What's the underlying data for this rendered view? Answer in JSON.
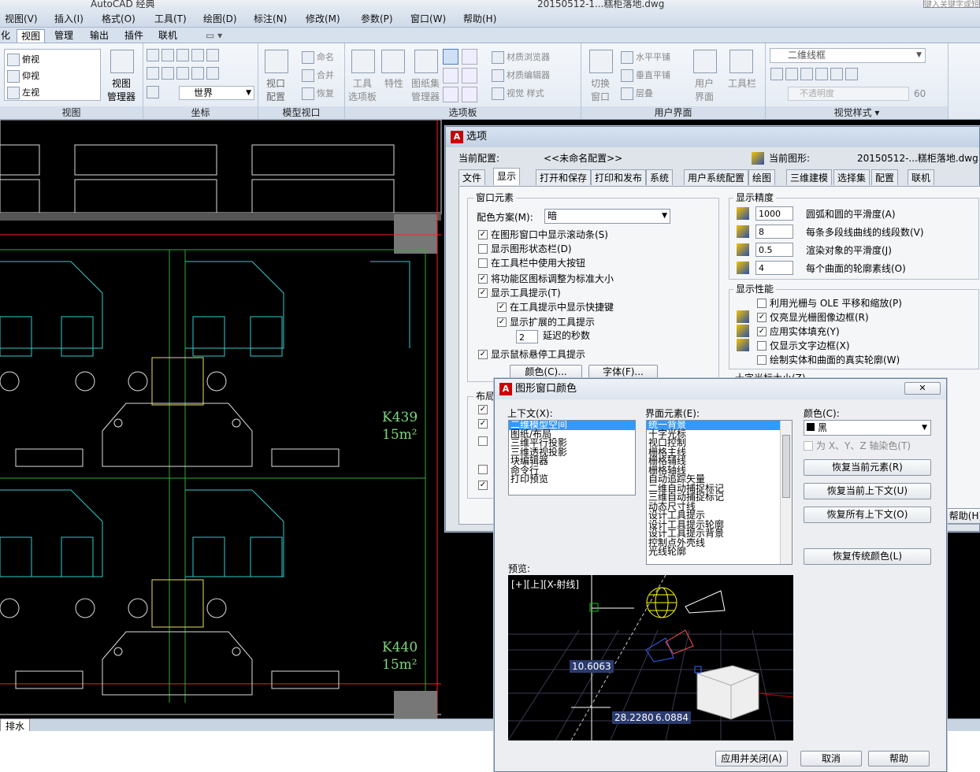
{
  "app": {
    "title_fragments": [
      "AutoCAD 经典",
      "20150512-1...糕柜落地.dwg"
    ],
    "search_placeholder": "键入关键字或短语"
  },
  "menu": [
    "视图(V)",
    "插入(I)",
    "格式(O)",
    "工具(T)",
    "绘图(D)",
    "标注(N)",
    "修改(M)",
    "参数(P)",
    "窗口(W)",
    "帮助(H)"
  ],
  "ribbon_tabs": [
    "化",
    "视图",
    "管理",
    "输出",
    "插件",
    "联机"
  ],
  "ribbon": {
    "view_group": {
      "items": [
        "俯视",
        "仰视",
        "左视"
      ],
      "big_button": "视图\n管理器",
      "label": "视图"
    },
    "coords_group": {
      "world": "世界",
      "label": "坐标"
    },
    "model_viewport_group": {
      "config": "视口\n配置",
      "items": [
        "命名",
        "合并",
        "恢复"
      ],
      "label": "模型视口"
    },
    "palettes_group": {
      "buttons": [
        "工具\n选项板",
        "特性",
        "图纸集\n管理器"
      ],
      "label": "选项板"
    },
    "ui_group": {
      "items": [
        "材质浏览器",
        "材质编辑器",
        "视觉 样式"
      ],
      "switch": "切换\n窗口",
      "tile": [
        "水平平铺",
        "垂直平铺",
        "层叠"
      ],
      "user_ui": "用户\n界面",
      "toolbar": "工具栏",
      "label": "用户界面"
    },
    "visual_styles_group": {
      "style": "二维线框",
      "opacity_label": "不透明度",
      "opacity_value": "60",
      "label": "视觉样式"
    }
  },
  "drawing": {
    "room_labels": [
      {
        "name": "K439",
        "area": "15m²"
      },
      {
        "name": "K440",
        "area": "15m²"
      }
    ],
    "tab_label": "排水",
    "colors": {
      "background": "#000000",
      "lines": "#ffffff",
      "cyan": "#33cccc",
      "green": "#33aa33",
      "red": "#ff2020",
      "yellow": "#e8e060",
      "label": "#7dd87d"
    }
  },
  "options": {
    "title": "选项",
    "current_profile_label": "当前配置:",
    "current_profile_value": "<<未命名配置>>",
    "current_drawing_label": "当前图形:",
    "current_drawing_value": "20150512-...糕柜落地.dwg",
    "tabs": [
      "文件",
      "显示",
      "打开和保存",
      "打印和发布",
      "系统",
      "用户系统配置",
      "绘图",
      "三维建模",
      "选择集",
      "配置",
      "联机"
    ],
    "window_elements": {
      "title": "窗口元素",
      "scheme_label": "配色方案(M):",
      "scheme_value": "暗",
      "checks": [
        {
          "label": "在图形窗口中显示滚动条(S)",
          "on": true
        },
        {
          "label": "显示图形状态栏(D)",
          "on": false
        },
        {
          "label": "在工具栏中使用大按钮",
          "on": false
        },
        {
          "label": "将功能区图标调整为标准大小",
          "on": true
        },
        {
          "label": "显示工具提示(T)",
          "on": true
        },
        {
          "label": "在工具提示中显示快捷键",
          "on": true
        },
        {
          "label": "显示扩展的工具提示",
          "on": true
        }
      ],
      "delay_value": "2",
      "delay_label": "延迟的秒数",
      "hover_label": "显示鼠标悬停工具提示",
      "colors_btn": "颜色(C)...",
      "fonts_btn": "字体(F)..."
    },
    "layout_title": "布局",
    "display_resolution": {
      "title": "显示精度",
      "rows": [
        {
          "value": "1000",
          "label": "圆弧和圆的平滑度(A)"
        },
        {
          "value": "8",
          "label": "每条多段线曲线的线段数(V)"
        },
        {
          "value": "0.5",
          "label": "渲染对象的平滑度(J)"
        },
        {
          "value": "4",
          "label": "每个曲面的轮廓素线(O)"
        }
      ]
    },
    "display_performance": {
      "title": "显示性能",
      "checks": [
        {
          "label": "利用光栅与 OLE 平移和缩放(P)",
          "on": false
        },
        {
          "label": "仅亮显光栅图像边框(R)",
          "on": true
        },
        {
          "label": "应用实体填充(Y)",
          "on": true
        },
        {
          "label": "仅显示文字边框(X)",
          "on": false
        },
        {
          "label": "绘制实体和曲面的真实轮廓(W)",
          "on": false
        }
      ]
    },
    "crosshair_label": "十字光标大小(Z)",
    "help_btn": "帮助(H)"
  },
  "colors_dialog": {
    "title": "图形窗口颜色",
    "context_label": "上下文(X):",
    "contexts": [
      "二维模型空间",
      "图纸/布局",
      "三维平行投影",
      "三维透视投影",
      "块编辑器",
      "命令行",
      "打印预览"
    ],
    "elements_label": "界面元素(E):",
    "elements": [
      "统一背景",
      "十字光标",
      "视口控制",
      "栅格主线",
      "栅格辅线",
      "栅格轴线",
      "自动追踪矢量",
      "二维自动捕捉标记",
      "三维自动捕捉标记",
      "动态尺寸线",
      "设计工具提示",
      "设计工具提示轮廓",
      "设计工具提示背景",
      "控制点外壳线",
      "光线轮廓"
    ],
    "color_label": "颜色(C):",
    "color_value": "黑",
    "tint_label": "为 X、Y、Z 轴染色(T)",
    "buttons": [
      "恢复当前元素(R)",
      "恢复当前上下文(U)",
      "恢复所有上下文(O)",
      "恢复传统颜色(L)"
    ],
    "preview_label": "预览:",
    "preview_header": "[+][上][X-射线]",
    "preview_values": [
      "10.6063",
      "28.2280",
      "6.0884"
    ],
    "footer": [
      "应用并关闭(A)",
      "取消",
      "帮助"
    ]
  }
}
